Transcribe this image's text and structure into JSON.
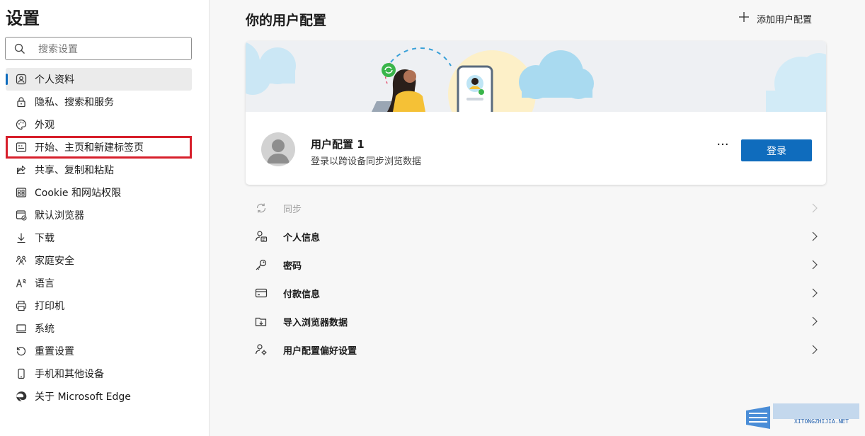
{
  "sidebar": {
    "title": "设置",
    "search_placeholder": "搜索设置",
    "items": [
      {
        "label": "个人资料",
        "icon": "profile-icon"
      },
      {
        "label": "隐私、搜索和服务",
        "icon": "lock-icon"
      },
      {
        "label": "外观",
        "icon": "palette-icon"
      },
      {
        "label": "开始、主页和新建标签页",
        "icon": "new-tab-icon"
      },
      {
        "label": "共享、复制和粘贴",
        "icon": "share-icon"
      },
      {
        "label": "Cookie 和网站权限",
        "icon": "site-permissions-icon"
      },
      {
        "label": "默认浏览器",
        "icon": "default-browser-icon"
      },
      {
        "label": "下载",
        "icon": "download-icon"
      },
      {
        "label": "家庭安全",
        "icon": "family-icon"
      },
      {
        "label": "语言",
        "icon": "language-icon"
      },
      {
        "label": "打印机",
        "icon": "printer-icon"
      },
      {
        "label": "系统",
        "icon": "system-icon"
      },
      {
        "label": "重置设置",
        "icon": "reset-icon"
      },
      {
        "label": "手机和其他设备",
        "icon": "phone-icon"
      },
      {
        "label": "关于 Microsoft Edge",
        "icon": "edge-logo-icon"
      }
    ]
  },
  "main": {
    "title": "你的用户配置",
    "add_profile": "添加用户配置",
    "profile": {
      "name": "用户配置 1",
      "description": "登录以跨设备同步浏览数据",
      "more": "···",
      "login_label": "登录"
    },
    "rows": [
      {
        "label": "同步",
        "icon": "sync-icon",
        "disabled": true
      },
      {
        "label": "个人信息",
        "icon": "personal-info-icon"
      },
      {
        "label": "密码",
        "icon": "key-icon"
      },
      {
        "label": "付款信息",
        "icon": "card-icon"
      },
      {
        "label": "导入浏览器数据",
        "icon": "import-icon"
      },
      {
        "label": "用户配置偏好设置",
        "icon": "profile-prefs-icon"
      }
    ]
  },
  "colors": {
    "accent": "#0f6cbd",
    "highlight_box": "#d71f2b"
  },
  "watermark": {
    "text": "XITONGZHIJIA.NET"
  }
}
